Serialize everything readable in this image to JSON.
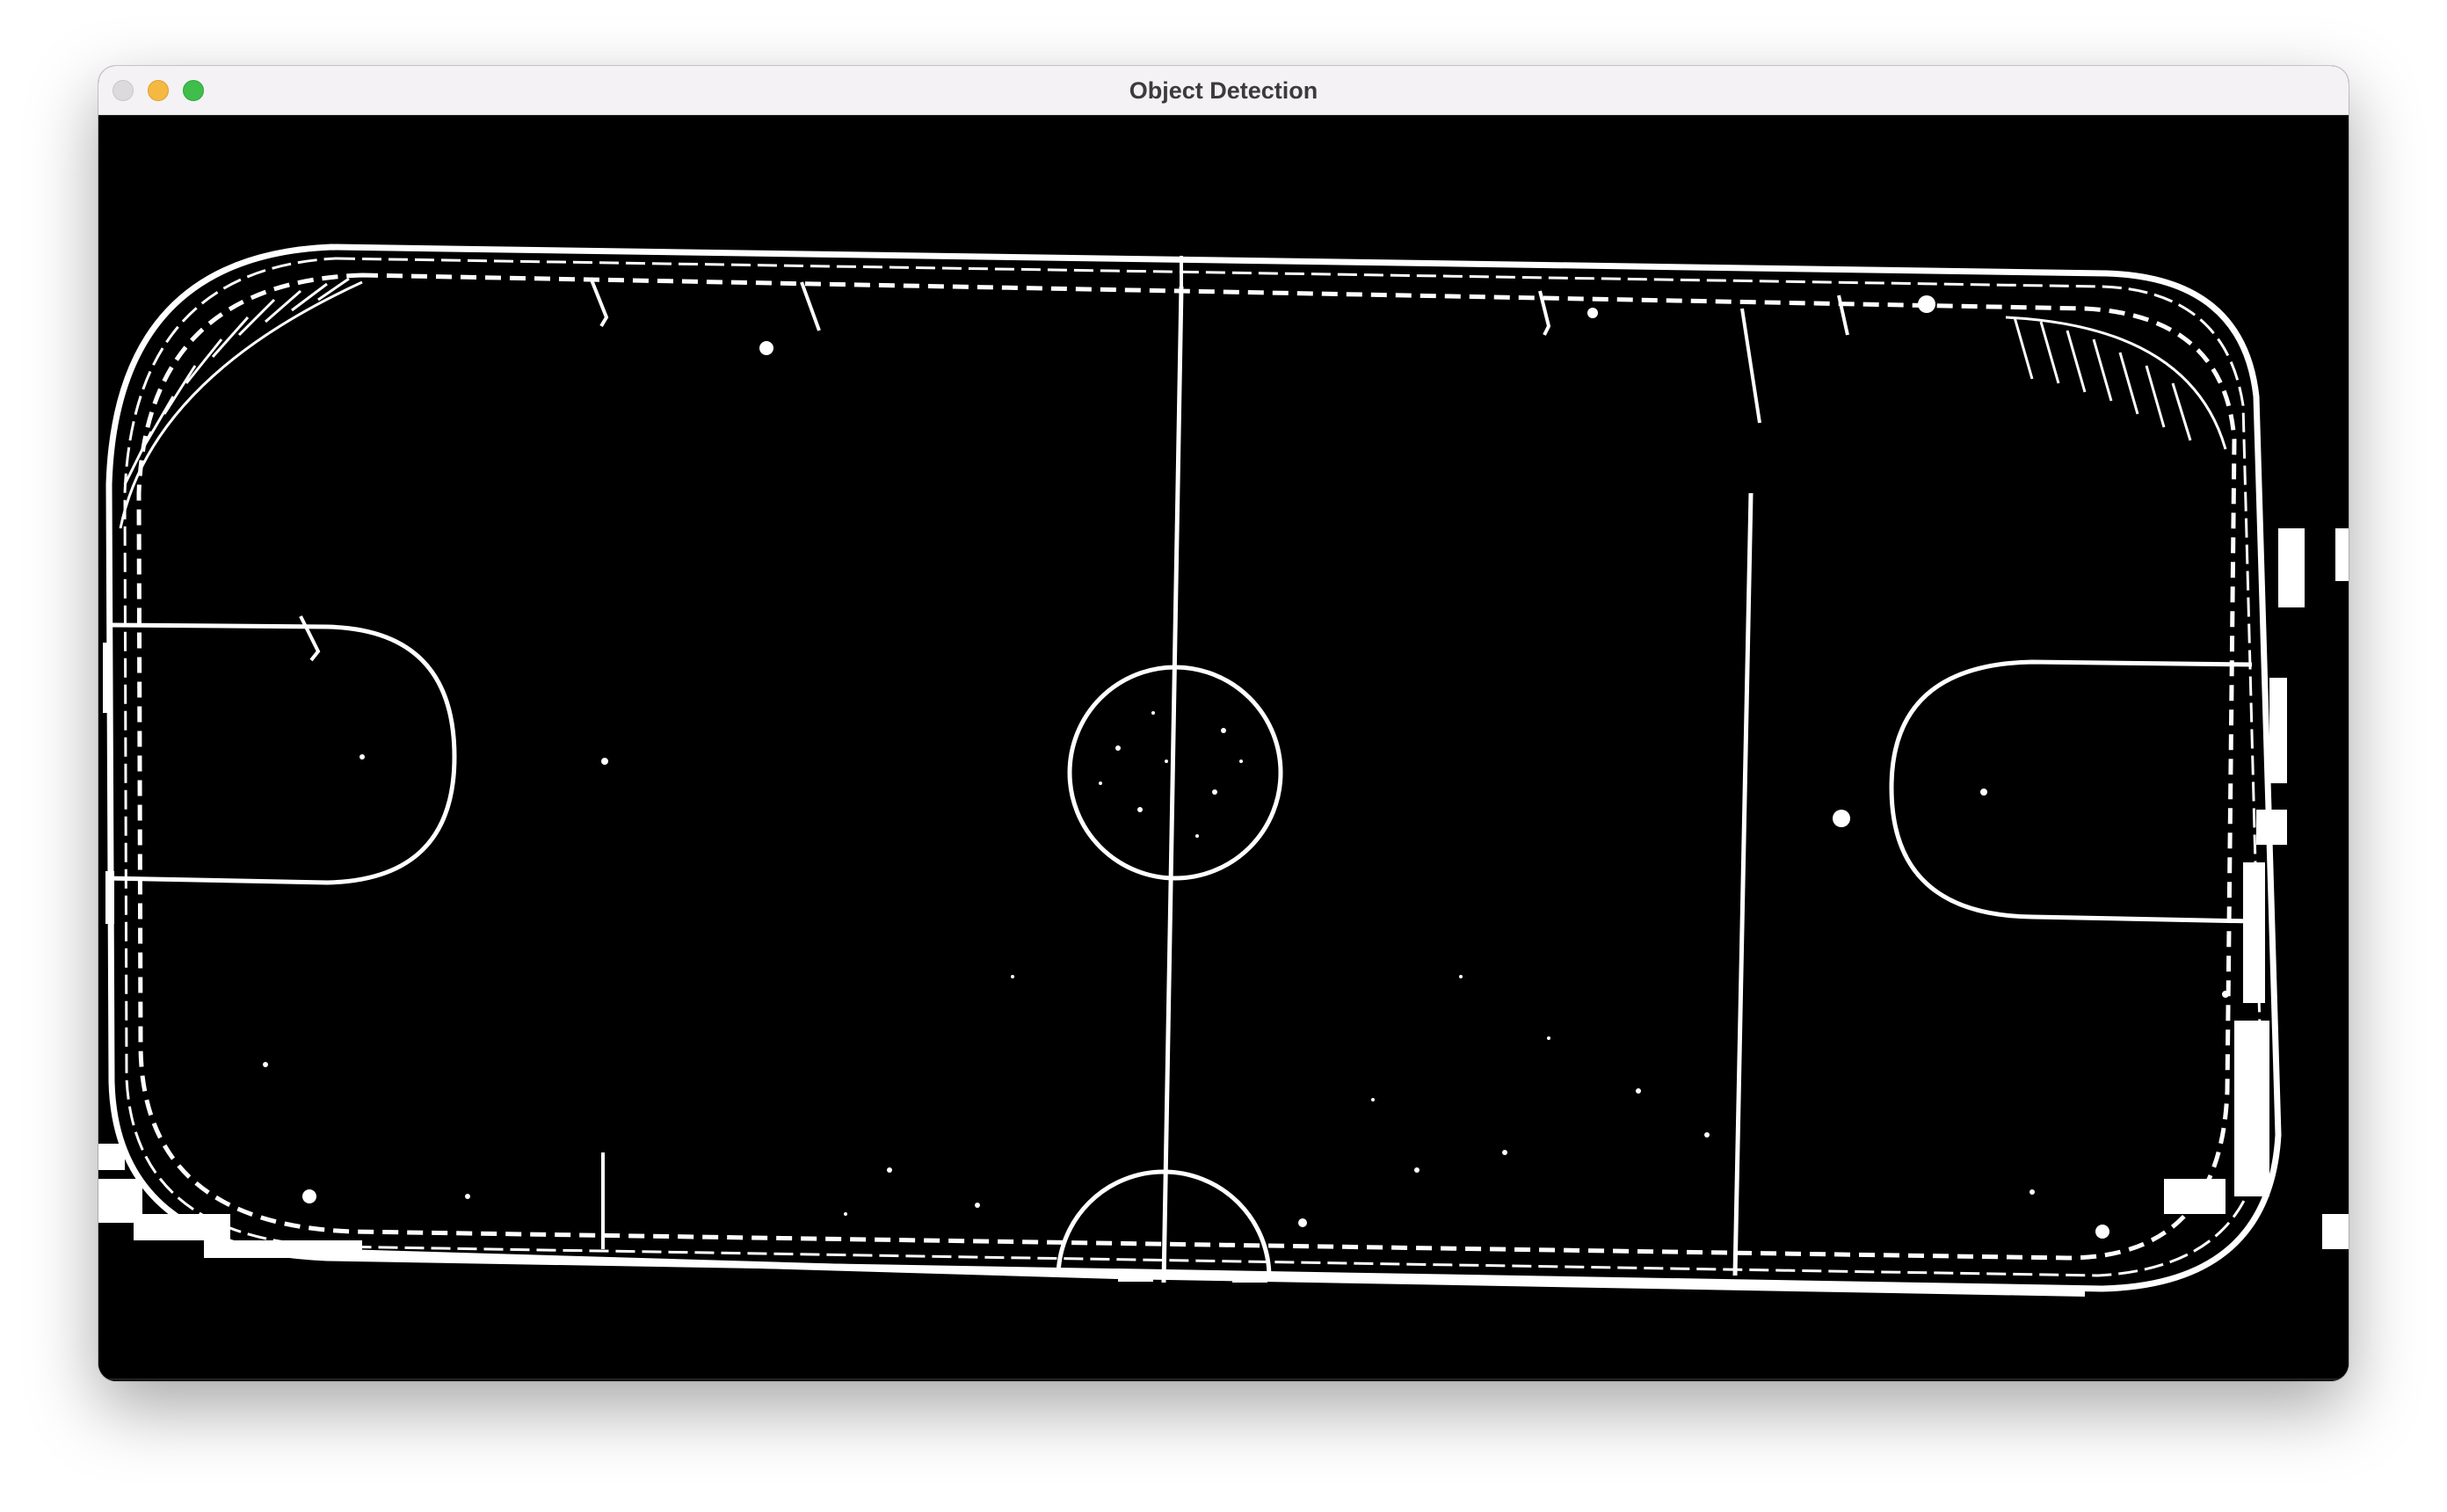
{
  "window": {
    "title": "Object Detection",
    "buttons": {
      "close": "close",
      "minimize": "minimize",
      "maximize": "maximize"
    }
  },
  "canvas": {
    "content": "binary thresholded overhead view of rink",
    "background": "#000000",
    "foreground": "#ffffff"
  },
  "colors": {
    "titlebar_bg": "#f4f2f4",
    "title_text": "#3b3b3b",
    "close": "#dcdadc",
    "minimize": "#f5b841",
    "maximize": "#3fbe4c"
  }
}
